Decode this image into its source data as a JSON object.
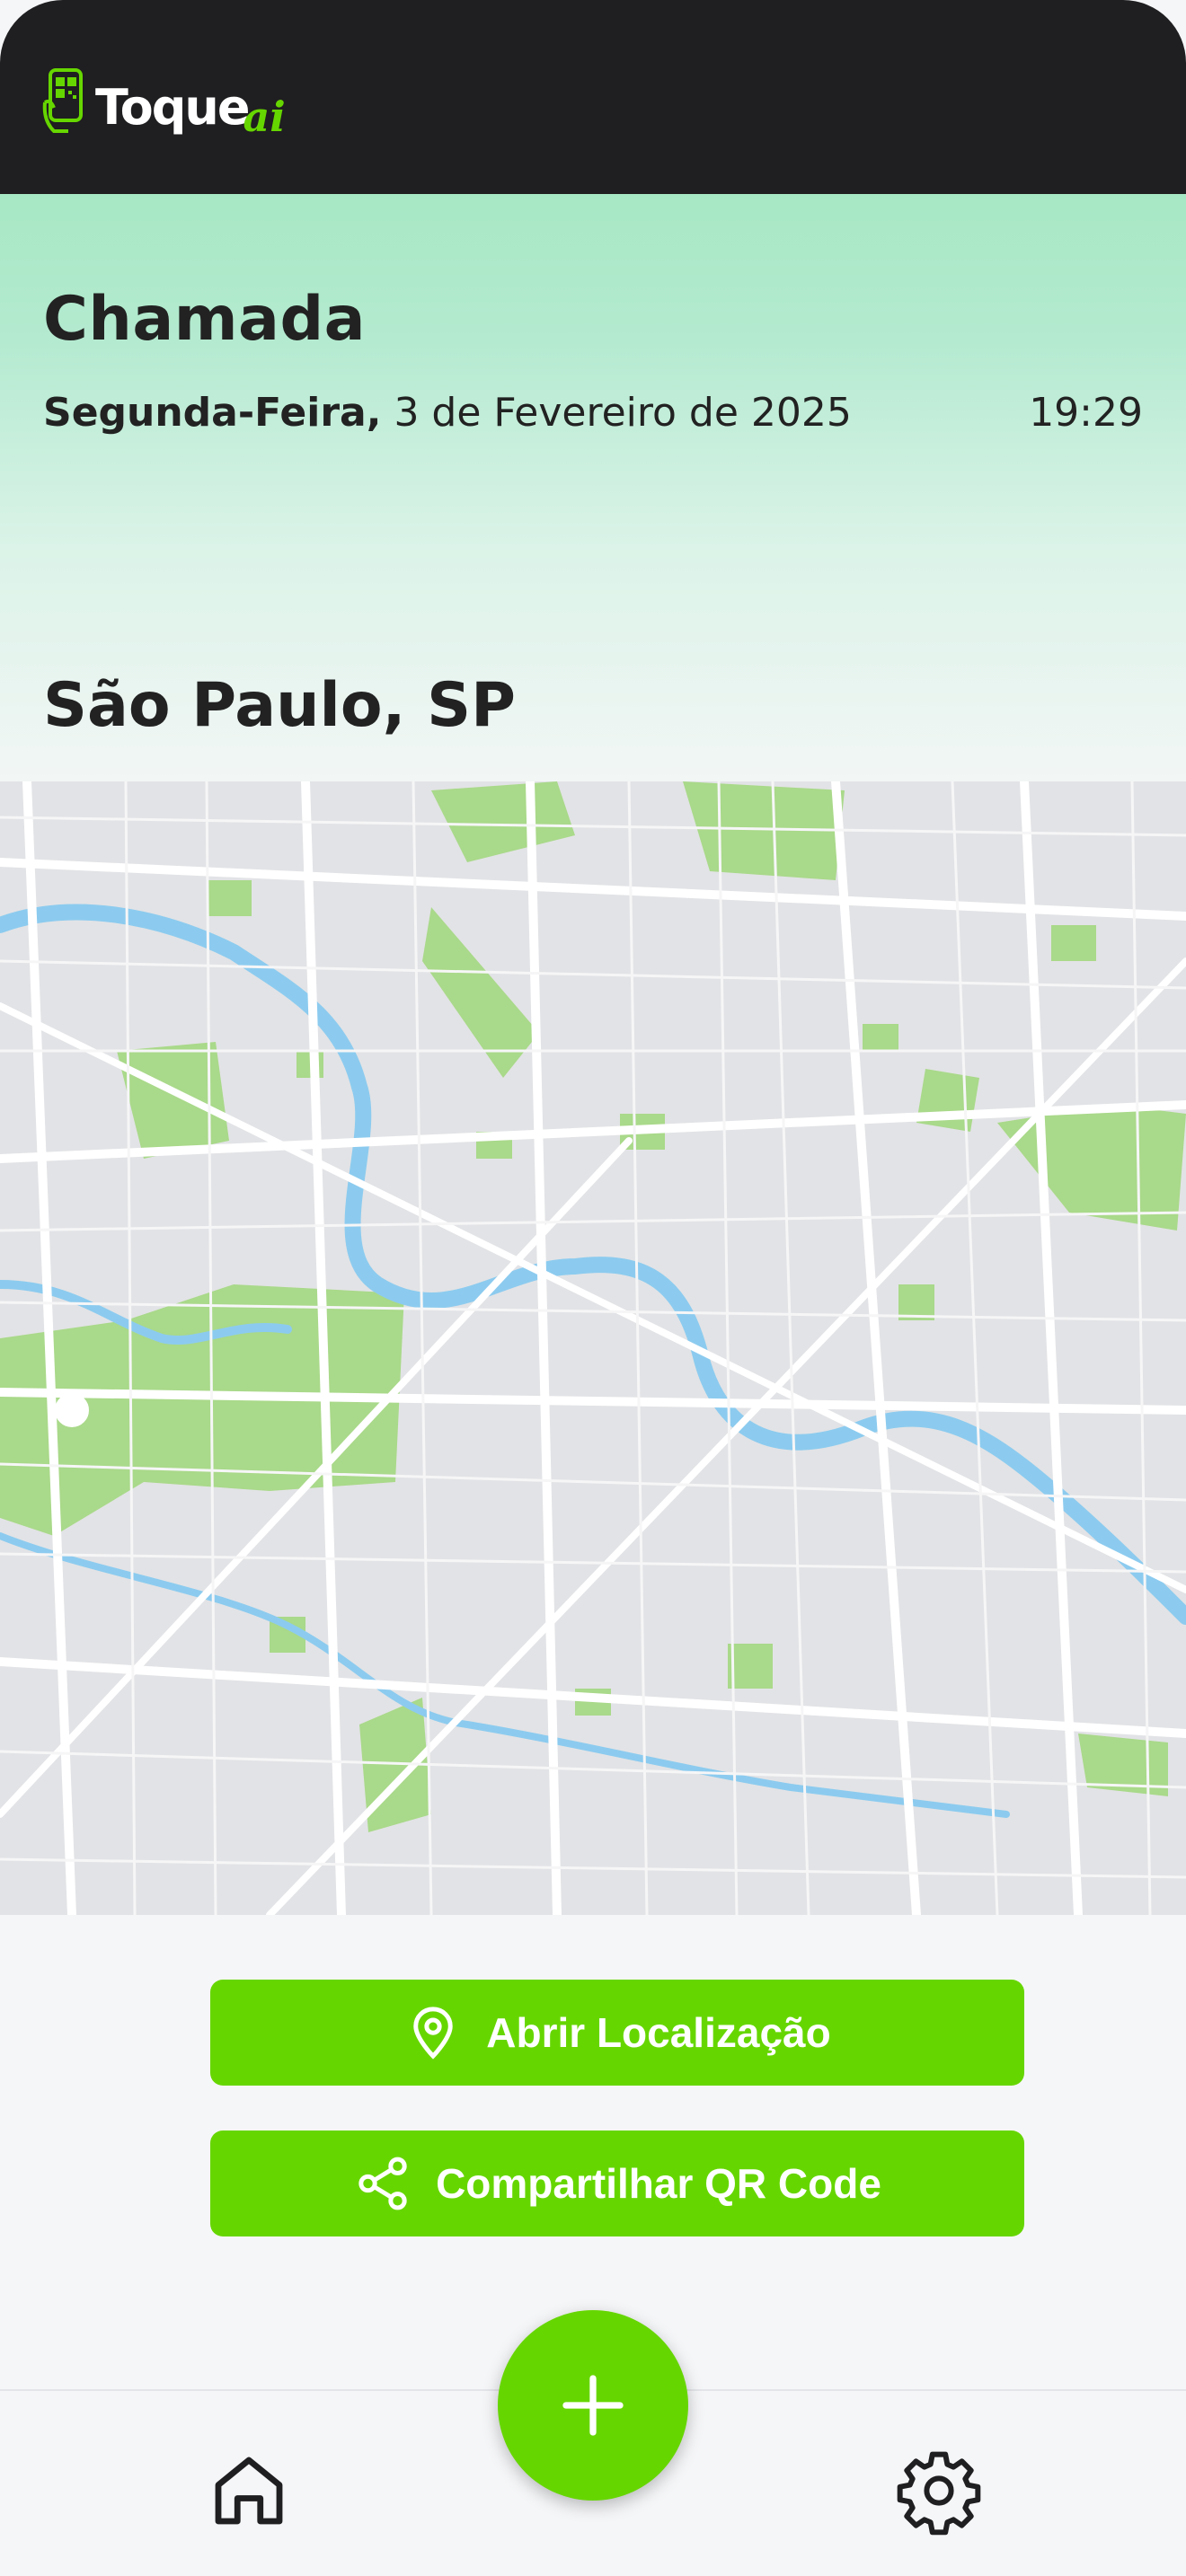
{
  "app": {
    "brand": "Toque",
    "brand_suffix": "ai",
    "brand_icon": "phone-qr-icon"
  },
  "hero": {
    "title": "Chamada",
    "weekday": "Segunda-Feira,",
    "date": "3 de Fevereiro de 2025",
    "time": "19:29",
    "location": "São Paulo, SP"
  },
  "map": {
    "icon": "city-map",
    "colors": {
      "land": "#e2e3e6",
      "road": "#ffffff",
      "park": "#a9d98a",
      "water": "#8ccbef"
    }
  },
  "actions": {
    "open_location": {
      "label": "Abrir Localização",
      "icon": "map-pin-icon"
    },
    "share_qr": {
      "label": "Compartilhar QR Code",
      "icon": "share-icon"
    }
  },
  "bottom_nav": {
    "home_icon": "home-icon",
    "add_icon": "plus-icon",
    "settings_icon": "gear-icon"
  },
  "colors": {
    "accent": "#66d600",
    "header_bg": "#1f1e20",
    "text": "#222222"
  }
}
